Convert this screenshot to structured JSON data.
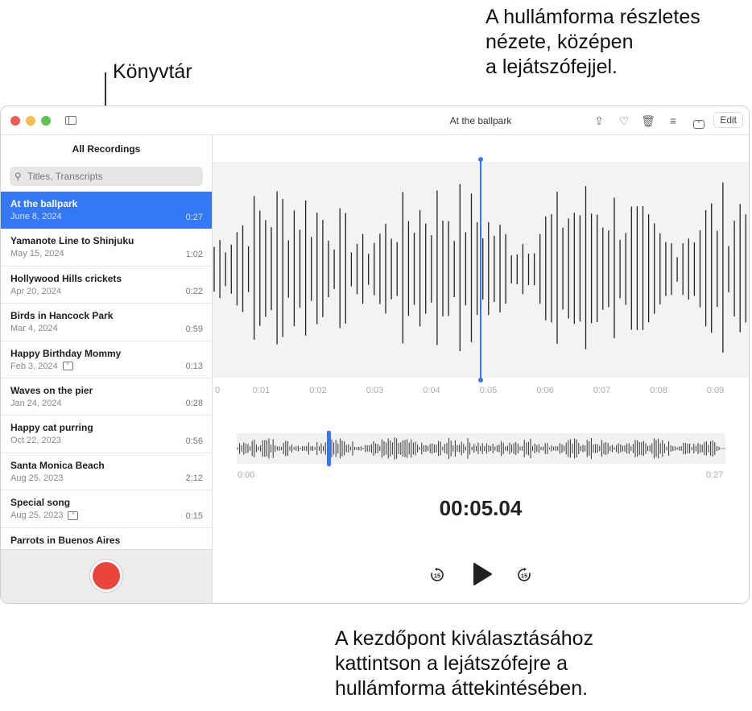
{
  "callouts": {
    "library": "Könyvtár",
    "detail": [
      "A hullámforma részletes",
      "nézete, középen",
      "a lejátszófejjel."
    ],
    "overview": [
      "A kezdőpont kiválasztásához",
      "kattintson a lejátszófejre a",
      "hullámforma áttekintésében."
    ]
  },
  "window": {
    "title": "At the ballpark",
    "edit_label": "Edit",
    "toolbar_icons": [
      "share-icon",
      "heart-icon",
      "trash-icon",
      "sliders-icon",
      "transcript-icon"
    ],
    "traffic_colors": [
      "#ec5f57",
      "#f4bd4f",
      "#5fc454"
    ]
  },
  "sidebar": {
    "title": "All Recordings",
    "search_placeholder": "Titles, Transcripts",
    "items": [
      {
        "name": "At the ballpark",
        "date": "June 8, 2024",
        "duration": "0:27",
        "selected": true
      },
      {
        "name": "Yamanote Line to Shinjuku",
        "date": "May 15, 2024",
        "duration": "1:02"
      },
      {
        "name": "Hollywood Hills crickets",
        "date": "Apr 20, 2024",
        "duration": "0:22"
      },
      {
        "name": "Birds in Hancock Park",
        "date": "Mar 4, 2024",
        "duration": "0:59"
      },
      {
        "name": "Happy Birthday Mommy",
        "date": "Feb 3, 2024",
        "duration": "0:13",
        "transcript": true
      },
      {
        "name": "Waves on the pier",
        "date": "Jan 24, 2024",
        "duration": "0:28"
      },
      {
        "name": "Happy cat purring",
        "date": "Oct 22, 2023",
        "duration": "0:56"
      },
      {
        "name": "Santa Monica Beach",
        "date": "Aug 25, 2023",
        "duration": "2:12"
      },
      {
        "name": "Special song",
        "date": "Aug 25, 2023",
        "duration": "0:15",
        "transcript": true
      },
      {
        "name": "Parrots in Buenos Aires",
        "date": "",
        "duration": ""
      }
    ]
  },
  "player": {
    "ticks": [
      "0",
      "0:01",
      "0:02",
      "0:03",
      "0:04",
      "0:05",
      "0:06",
      "0:07",
      "0:08",
      "0:09"
    ],
    "overview_start": "0:00",
    "overview_end": "0:27",
    "current_time": "00:05.04",
    "skip_back_label": "15",
    "skip_forward_label": "15",
    "accent": "#3478f6"
  }
}
